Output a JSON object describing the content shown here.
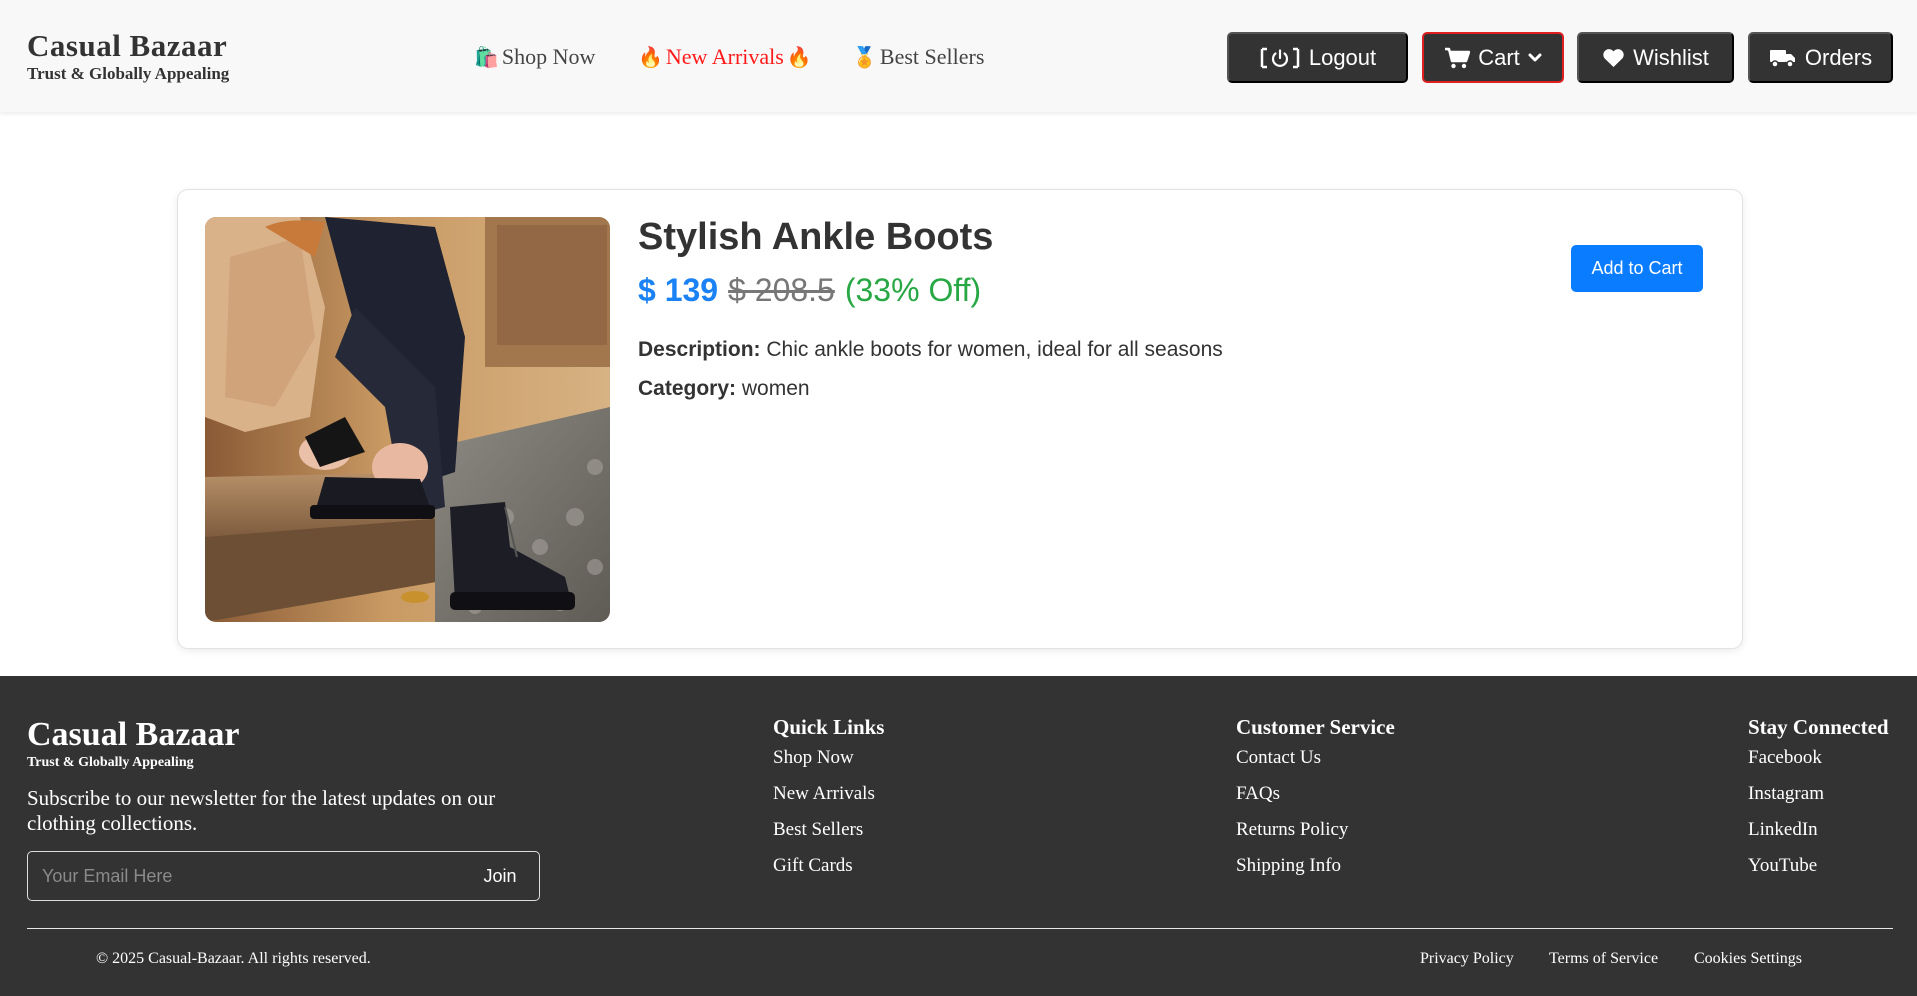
{
  "header": {
    "brand": {
      "name": "Casual Bazaar",
      "tagline": "Trust & Globally Appealing"
    },
    "nav": [
      {
        "emoji": "🛍️",
        "label": "Shop Now"
      },
      {
        "emoji": "🔥",
        "label": "New Arrivals",
        "emoji_after": "🔥",
        "color": "#ff1a1a"
      },
      {
        "emoji": "🏅",
        "label": "Best Sellers"
      }
    ],
    "buttons": {
      "logout": {
        "icon": "power-icon",
        "label": "Logout"
      },
      "cart": {
        "icon": "cart-icon",
        "label": "Cart",
        "dropdown_icon": "chevron-down-icon"
      },
      "wishlist": {
        "icon": "heart-icon",
        "label": "Wishlist"
      },
      "orders": {
        "icon": "truck-icon",
        "label": "Orders"
      }
    }
  },
  "product": {
    "title": "Stylish Ankle Boots",
    "price": "$ 139",
    "original_price": "$ 208.5",
    "discount": "(33% Off)",
    "description_label": "Description:",
    "description": "Chic ankle boots for women, ideal for all seasons",
    "category_label": "Category:",
    "category": "women",
    "add_to_cart": "Add to Cart"
  },
  "footer": {
    "brand": {
      "name": "Casual Bazaar",
      "tagline": "Trust & Globally Appealing"
    },
    "newsletter_text": "Subscribe to our newsletter for the latest updates on our clothing collections.",
    "email_placeholder": "Your Email Here",
    "join_label": "Join",
    "quick_links": {
      "title": "Quick Links",
      "items": [
        "Shop Now",
        "New Arrivals",
        "Best Sellers",
        "Gift Cards"
      ]
    },
    "customer_service": {
      "title": "Customer Service",
      "items": [
        "Contact Us",
        "FAQs",
        "Returns Policy",
        "Shipping Info"
      ]
    },
    "stay_connected": {
      "title": "Stay Connected",
      "items": [
        "Facebook",
        "Instagram",
        "LinkedIn",
        "YouTube"
      ]
    },
    "copyright": "© 2025 Casual-Bazaar. All rights reserved.",
    "legal": [
      "Privacy Policy",
      "Terms of Service",
      "Cookies Settings"
    ]
  },
  "colors": {
    "header_bg": "#f8f8f8",
    "button_bg": "#333333",
    "price": "#1a82f5",
    "discount": "#28a745",
    "new_arrivals": "#ff1a1a",
    "add_to_cart": "#0a7cff",
    "footer_bg": "#333333"
  }
}
